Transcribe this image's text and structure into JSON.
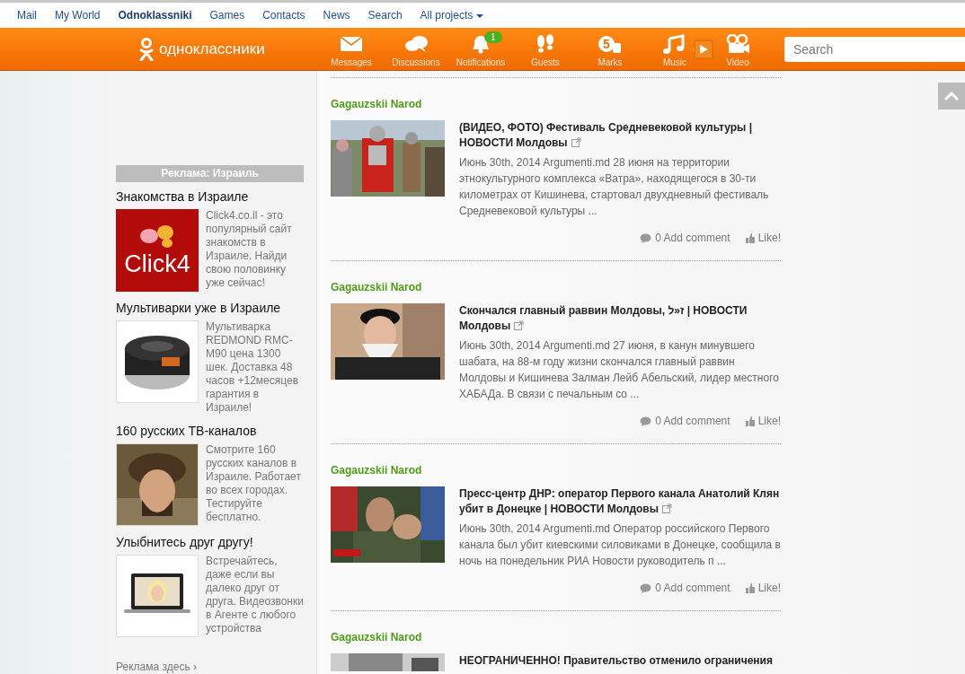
{
  "top_links": [
    {
      "label": "Mail",
      "selected": false
    },
    {
      "label": "My World",
      "selected": false
    },
    {
      "label": "Odnoklassniki",
      "selected": true
    },
    {
      "label": "Games",
      "selected": false
    },
    {
      "label": "Contacts",
      "selected": false
    },
    {
      "label": "News",
      "selected": false
    },
    {
      "label": "Search",
      "selected": false
    },
    {
      "label": "All projects",
      "selected": false,
      "dropdown": true
    }
  ],
  "header": {
    "logo_text": "одноклассники",
    "nav": [
      {
        "kind": "messages",
        "label": "Messages"
      },
      {
        "kind": "discussions",
        "label": "Discussions"
      },
      {
        "kind": "notifications",
        "label": "Notifications",
        "badge": "1"
      },
      {
        "kind": "guests",
        "label": "Guests"
      },
      {
        "kind": "marks",
        "label": "Marks",
        "icon_text": "5"
      },
      {
        "kind": "music",
        "label": "Music"
      },
      {
        "kind": "player"
      },
      {
        "kind": "video",
        "label": "Video"
      }
    ],
    "search": {
      "placeholder": "Search"
    }
  },
  "sidebar": {
    "ad_header": "Реклама: Израиль",
    "ads": [
      {
        "title": "Знакомства в Израиле",
        "kind": "logo",
        "logo_text": "Click4",
        "text": "Click4.co.il - это популярный сайт знакомств в Израиле. Найди свою половинку уже сейчас!"
      },
      {
        "title": "Мультиварки уже в Израиле",
        "kind": "cooker",
        "text": "Мультиварка REDMOND RMC-M90 цена 1300 шек. Доставка 48 часов +12месяцев гарантия в Израиле!"
      },
      {
        "title": "160 русских ТВ-каналов",
        "kind": "picture",
        "text": "Смотрите 160 русских каналов в Израиле. Работает во всех городах. Тестируйте бесплатно."
      },
      {
        "title": "Улыбнитесь друг другу!",
        "kind": "laptop",
        "text": "Встречайтесь, даже если вы далеко друг от друга. Видеозвонки в Агенте с любого устройства"
      }
    ],
    "ad_footer": "Реклама здесь ›"
  },
  "feed": {
    "posts": [
      {
        "group": "Gagauzskii Narod",
        "title": "(ВИДЕО, ФОТО) Фестиваль Средневековой культуры | НОВОСТИ Молдовы",
        "excerpt": "Июнь 30th, 2014 Argumenti.md 28 июня на территории этнокультурного комплекса «Ватра», находящегося в 30-ти километрах от Кишинева, стартовал двухдневный фестиваль Средневековой культуры ...",
        "comments": "0 Add comment",
        "like": "Like!"
      },
      {
        "group": "Gagauzskii Narod",
        "title": "Скончался главный раввин Молдовы, ז«ל | НОВОСТИ Молдовы",
        "excerpt": "Июнь 30th, 2014 Argumenti.md 27 июня, в канун минувшего шабата, на 88-м году жизни скончался главный раввин Молдовы и Кишинева Залман Лейб Абельский, лидер местного ХАБАДа. В связи с печальным со ...",
        "comments": "0 Add comment",
        "like": "Like!"
      },
      {
        "group": "Gagauzskii Narod",
        "title": "Пресс-центр ДНР: оператор Первого канала Анатолий Клян убит в Донецке | НОВОСТИ Молдовы",
        "excerpt": "Июнь 30th, 2014 Argumenti.md Оператор российского Первого канала был убит киевскими силовиками в Донецке, сообщила в ночь на понедельник РИА Новости руководитель п ...",
        "comments": "0 Add comment",
        "like": "Like!"
      },
      {
        "group": "Gagauzskii Narod",
        "title": "НЕОГРАНИЧЕННО! Правительство отменило ограничения"
      }
    ]
  }
}
